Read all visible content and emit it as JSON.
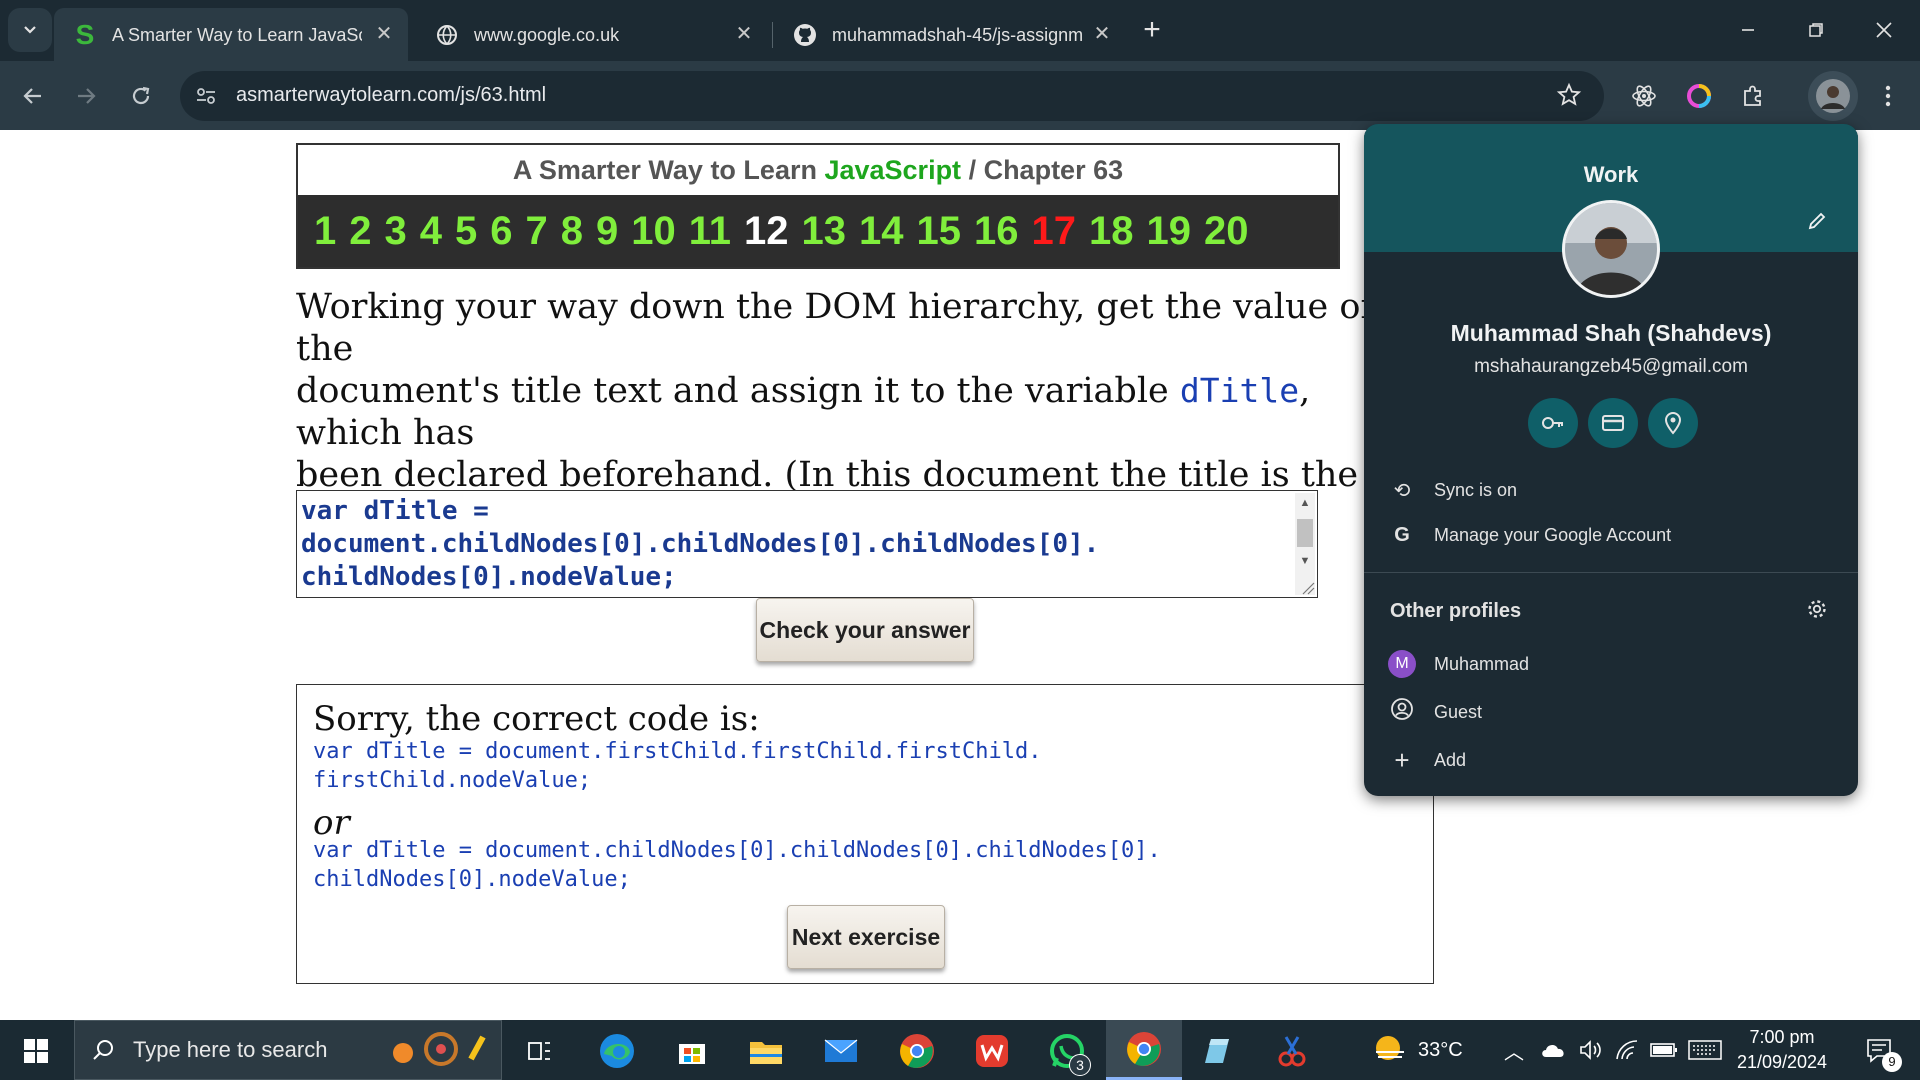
{
  "browser": {
    "tabs": [
      {
        "title": "A Smarter Way to Learn JavaScr",
        "active": true
      },
      {
        "title": "www.google.co.uk",
        "active": false
      },
      {
        "title": "muhammadshah-45/js-assignm",
        "active": false
      }
    ],
    "url": "asmarterwaytolearn.com/js/63.html"
  },
  "page": {
    "header_prefix": "A Smarter Way to Learn ",
    "header_js": "JavaScript",
    "header_suffix": " / Chapter 63",
    "chapters": [
      "1",
      "2",
      "3",
      "4",
      "5",
      "6",
      "7",
      "8",
      "9",
      "10",
      "11",
      "12",
      "13",
      "14",
      "15",
      "16",
      "17",
      "18",
      "19",
      "20"
    ],
    "current_chapter": "12",
    "red_chapter": "17",
    "instructions_1": "Working your way down the DOM hierarchy, get the value of the\ndocument's title text and assign it to the variable ",
    "instructions_var": "dTitle",
    "instructions_2": ", which has\nbeen declared beforehand. (In this document the title is the first child\nof the head.)",
    "answer": "var dTitle =\ndocument.childNodes[0].childNodes[0].childNodes[0].\nchildNodes[0].nodeValue;",
    "check_button": "Check your answer",
    "result_heading": "Sorry, the correct code is:",
    "result_code_1": "var dTitle = document.firstChild.firstChild.firstChild.\nfirstChild.nodeValue;",
    "result_or": "or",
    "result_code_2": "var dTitle = document.childNodes[0].childNodes[0].childNodes[0].\nchildNodes[0].nodeValue;",
    "next_button": "Next exercise"
  },
  "profile_menu": {
    "label": "Work",
    "name": "Muhammad Shah (Shahdevs)",
    "email": "mshahaurangzeb45@gmail.com",
    "sync": "Sync is on",
    "manage": "Manage your Google Account",
    "other_profiles_heading": "Other profiles",
    "profiles": [
      {
        "initial": "M",
        "name": "Muhammad"
      },
      {
        "name": "Guest"
      },
      {
        "name": "Add"
      }
    ]
  },
  "taskbar": {
    "search_placeholder": "Type here to search",
    "weather": "33°C",
    "time": "7:00 pm",
    "date": "21/09/2024",
    "whatsapp_badge": "3",
    "notification_badge": "9"
  },
  "colors": {
    "chrome_dark": "#1c2a33",
    "profile_header": "#15555d",
    "chapter_green": "#80ee3c",
    "chapter_red": "#ff1a1a",
    "code_blue": "#1a3fb2"
  }
}
